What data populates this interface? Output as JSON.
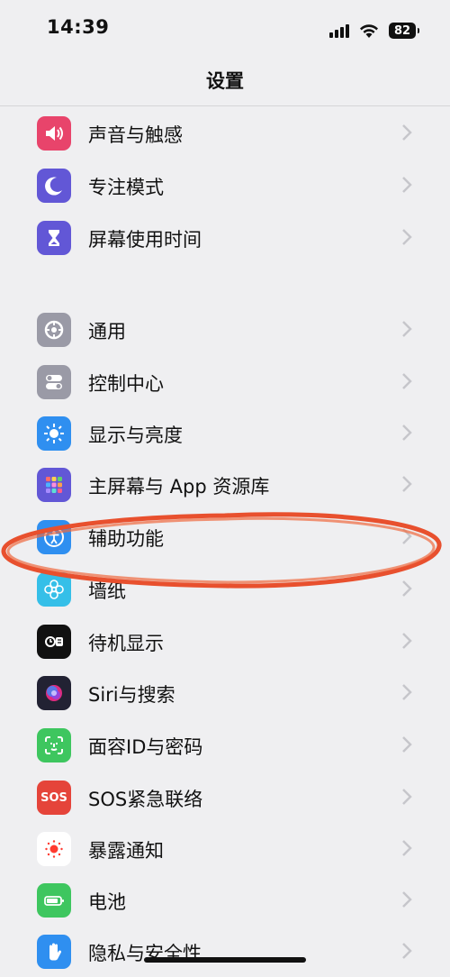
{
  "status_bar": {
    "time": "14:39",
    "battery": "82"
  },
  "nav": {
    "title": "设置"
  },
  "settings_items": [
    {
      "label": "声音与触感",
      "icon": "speaker-icon",
      "color": "#e8446b"
    },
    {
      "label": "专注模式",
      "icon": "moon-icon",
      "color": "#6257d6"
    },
    {
      "label": "屏幕使用时间",
      "icon": "hourglass-icon",
      "color": "#6257d6"
    },
    {
      "label": "通用",
      "icon": "gear-icon",
      "color": "#9a9aa6"
    },
    {
      "label": "控制中心",
      "icon": "toggles-icon",
      "color": "#9a9aa6"
    },
    {
      "label": "显示与亮度",
      "icon": "sun-icon",
      "color": "#2f8ff0"
    },
    {
      "label": "主屏幕与 App 资源库",
      "icon": "app-grid-icon",
      "color": "#6257d6"
    },
    {
      "label": "辅助功能",
      "icon": "accessibility-icon",
      "color": "#2f8ff0"
    },
    {
      "label": "墙纸",
      "icon": "flower-icon",
      "color": "#35bfe8"
    },
    {
      "label": "待机显示",
      "icon": "standby-icon",
      "color": "#111111"
    },
    {
      "label": "Siri与搜索",
      "icon": "siri-icon",
      "color": "#222233"
    },
    {
      "label": "面容ID与密码",
      "icon": "face-id-icon",
      "color": "#3ec65f"
    },
    {
      "label": "SOS紧急联络",
      "icon": "sos-icon",
      "color": "#e5443a"
    },
    {
      "label": "暴露通知",
      "icon": "exposure-icon",
      "color": "#ffffff"
    },
    {
      "label": "电池",
      "icon": "battery-icon",
      "color": "#3ec65f"
    },
    {
      "label": "隐私与安全性",
      "icon": "hand-icon",
      "color": "#2f8ff0"
    }
  ],
  "sos_text": "SOS"
}
